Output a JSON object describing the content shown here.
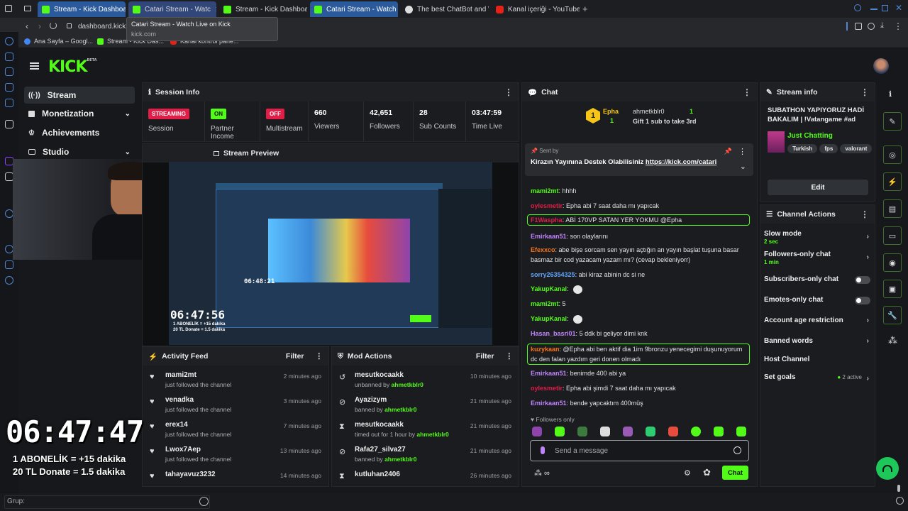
{
  "browser": {
    "tabs": [
      {
        "label": "Stream - Kick Dashboard",
        "fav": "k"
      },
      {
        "label": "Catari Stream - Watc",
        "fav": "k"
      },
      {
        "label": "Stream - Kick Dashboard",
        "fav": "k"
      },
      {
        "label": "Catari Stream - Watch Liv",
        "fav": "k"
      },
      {
        "label": "The best ChatBot and Wi",
        "fav": "gh"
      },
      {
        "label": "Kanal içeriği - YouTube St",
        "fav": "yt"
      }
    ],
    "address": "dashboard.kick.c",
    "tooltip_title": "Catari Stream - Watch Live on Kick",
    "tooltip_url": "kick.com",
    "bookmarks": [
      "Ana Sayfa – Googl...",
      "Stream - Kick Das...",
      "Kanal kontrol pane..."
    ]
  },
  "kick": {
    "logo": "KICK",
    "logo_badge": "BETA",
    "nav": [
      {
        "label": "Stream",
        "icon": "broadcast-icon"
      },
      {
        "label": "Monetization",
        "icon": "dollar-icon"
      },
      {
        "label": "Achievements",
        "icon": "trophy-icon"
      },
      {
        "label": "Studio",
        "icon": "camera-icon"
      }
    ]
  },
  "session": {
    "title": "Session Info",
    "metrics": [
      {
        "badge": "STREAMING",
        "label": "Session",
        "color": "#e11d48"
      },
      {
        "badge": "ON",
        "label": "Partner Income",
        "color": "#53fc18"
      },
      {
        "badge": "OFF",
        "label": "Multistream",
        "color": "#e11d48"
      },
      {
        "value": "660",
        "label": "Viewers"
      },
      {
        "value": "42,651",
        "label": "Followers"
      },
      {
        "value": "28",
        "label": "Sub Counts"
      },
      {
        "value": "03:47:59",
        "label": "Time Live"
      }
    ]
  },
  "preview": {
    "title": "Stream Preview",
    "inner_timer": "06:47:56",
    "inner_line1": "1 ABONELİK = +15 dakika",
    "inner_line2": "20 TL Donate = 1.5 dakika",
    "inner_small_timer": "06:48:21"
  },
  "overlay": {
    "timer": "06:47:47",
    "line1": "1 ABONELİK = +15 dakika",
    "line2": "20 TL Donate = 1.5 dakika"
  },
  "activity": {
    "title": "Activity Feed",
    "filter": "Filter",
    "items": [
      {
        "name": "mami2mt",
        "desc": "just followed the channel",
        "ago": "2 minutes ago"
      },
      {
        "name": "venadka",
        "desc": "just followed the channel",
        "ago": "3 minutes ago"
      },
      {
        "name": "erex14",
        "desc": "just followed the channel",
        "ago": "7 minutes ago"
      },
      {
        "name": "Lwox7Aep",
        "desc": "just followed the channel",
        "ago": "13 minutes ago"
      },
      {
        "name": "tahayavuz3232",
        "desc": "",
        "ago": "14 minutes ago"
      }
    ]
  },
  "mod": {
    "title": "Mod Actions",
    "filter": "Filter",
    "items": [
      {
        "name": "mesutkocaakk",
        "desc": "unbanned by",
        "by": "ahmetkblr0",
        "ago": "10 minutes ago",
        "icon": "↺"
      },
      {
        "name": "Ayazizym",
        "desc": "banned by",
        "by": "ahmetkblr0",
        "ago": "21 minutes ago",
        "icon": "⊘"
      },
      {
        "name": "mesutkocaakk",
        "desc": "timed out for 1 hour by",
        "by": "ahmetkblr0",
        "ago": "21 minutes ago",
        "icon": "⧗"
      },
      {
        "name": "Rafa27_silva27",
        "desc": "banned by",
        "by": "ahmetkblr0",
        "ago": "21 minutes ago",
        "icon": "⊘"
      },
      {
        "name": "kutluhan2406",
        "desc": "",
        "by": "",
        "ago": "26 minutes ago",
        "icon": "⧗"
      }
    ]
  },
  "chat": {
    "title": "Chat",
    "top_gifter": {
      "name": "Epha",
      "count": "1",
      "rank": "1",
      "gifter2": "ahmetkblr0",
      "count2": "1",
      "gift_text": "Gift 1 sub to take 3rd"
    },
    "pinned": {
      "sent_by": "Sent by",
      "message": "Kirazın Yayınına Destek Olabilisiniz ",
      "link": "https://kick.com/catari"
    },
    "messages": [
      {
        "user": "mami2mt",
        "color": "#53fc18",
        "text": "hhhh",
        "box": false
      },
      {
        "user": "oylesmetir",
        "color": "#e11d48",
        "text": "Epha abi 7 saat daha mı yapıcak",
        "box": false
      },
      {
        "user": "F1Waspha",
        "color": "#e11d48",
        "text": "ABİ 170VP SATAN YER YOKMU @Epha",
        "box": true
      },
      {
        "user": "Emirkaan51",
        "color": "#c084fc",
        "text": "son olaylarını",
        "box": false
      },
      {
        "user": "Efexxco",
        "color": "#f97316",
        "text": "abe bişe sorcam sen yayın açtığın an yayın başlat tuşuna basar basmaz bir cod yazacam yazam mı? (cevap bekleniyorr)",
        "box": false
      },
      {
        "user": "sorry26354325",
        "color": "#60a5fa",
        "text": "abi kiraz abinin dc si ne",
        "box": false
      },
      {
        "user": "YakupKanal",
        "color": "#53fc18",
        "text": "",
        "box": false
      },
      {
        "user": "mami2mt",
        "color": "#53fc18",
        "text": "5",
        "box": false
      },
      {
        "user": "YakupKanal",
        "color": "#53fc18",
        "text": "",
        "box": false
      },
      {
        "user": "Hasan_basri01",
        "color": "#c084fc",
        "text": "5 ddk bi geliyor dimi knk",
        "box": false
      },
      {
        "user": "kuzykaan",
        "color": "#f97316",
        "text": "@Epha abi ben aktif dia 1im 9bronzu yenecegimi duşunuyorum dc den falan yazdım geri donen olmadı",
        "box": true
      },
      {
        "user": "Emirkaan51",
        "color": "#c084fc",
        "text": "benimde 400 abi ya",
        "box": false
      },
      {
        "user": "oylesmetir",
        "color": "#e11d48",
        "text": "Epha abi şimdi 7 saat daha mı yapıcak",
        "box": false
      },
      {
        "user": "Emirkaan51",
        "color": "#c084fc",
        "text": "bende yapcaktım 400müş",
        "box": false
      }
    ],
    "followers_only": "Followers only",
    "input_placeholder": "Send a message",
    "send_label": "Chat"
  },
  "streaminfo": {
    "title": "Stream info",
    "stream_title": "SUBATHON YAPIYORUZ HADİ BAKALIM | !Vatangame #ad",
    "category": "Just Chatting",
    "tags": [
      "Turkish",
      "fps",
      "valorant"
    ],
    "edit": "Edit"
  },
  "actions": {
    "title": "Channel Actions",
    "items": [
      {
        "label": "Slow mode",
        "sub": "2 sec",
        "kind": "chev"
      },
      {
        "label": "Followers-only chat",
        "sub": "1 min",
        "kind": "chev"
      },
      {
        "label": "Subscribers-only chat",
        "sub": "",
        "kind": "toggle"
      },
      {
        "label": "Emotes-only chat",
        "sub": "",
        "kind": "toggle"
      },
      {
        "label": "Account age restriction",
        "sub": "",
        "kind": "chev"
      },
      {
        "label": "Banned words",
        "sub": "",
        "kind": "chev"
      },
      {
        "label": "Host Channel",
        "sub": "",
        "kind": "none"
      },
      {
        "label": "Set goals",
        "sub": "",
        "kind": "goal",
        "extra": "2 active"
      }
    ]
  },
  "taskbar": {
    "search_label": "Grup:"
  }
}
